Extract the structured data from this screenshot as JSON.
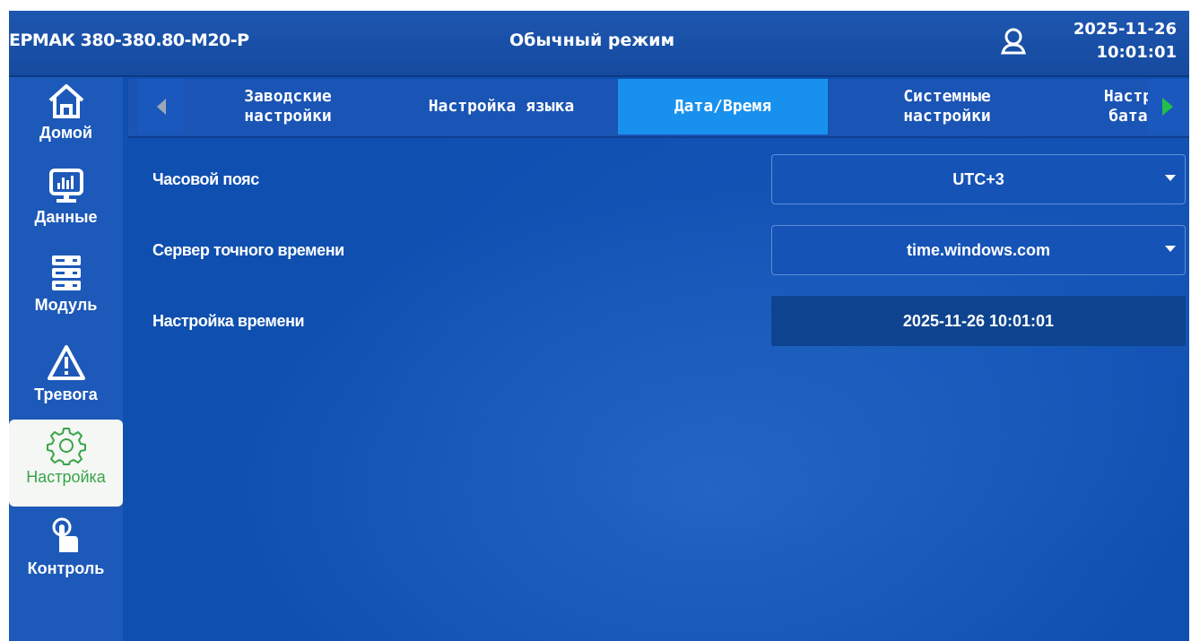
{
  "header": {
    "model": "ЕРМАК 380-380.80-М20-Р",
    "mode": "Обычный режим",
    "user_icon": "user-icon",
    "date": "2025-11-26",
    "time": "10:01:01"
  },
  "sidebar": {
    "items": [
      {
        "label": "Домой",
        "icon": "home-icon"
      },
      {
        "label": "Данные",
        "icon": "monitor-chart-icon"
      },
      {
        "label": "Модуль",
        "icon": "server-icon"
      },
      {
        "label": "Тревога",
        "icon": "warning-icon"
      },
      {
        "label": "Настройка",
        "icon": "gear-icon",
        "active": true
      },
      {
        "label": "Контроль",
        "icon": "touch-icon"
      }
    ]
  },
  "tabs": {
    "items": [
      {
        "label": "Заводские\nнастройки"
      },
      {
        "label": "Настройка языка"
      },
      {
        "label": "Дата/Время",
        "active": true
      },
      {
        "label": "Системные\nнастройки"
      },
      {
        "label": "Настр\nбата"
      }
    ]
  },
  "settings": {
    "timezone_label": "Часовой пояс",
    "timezone_value": "UTC+3",
    "ntp_label": "Сервер точного времени",
    "ntp_value": "time.windows.com",
    "time_label": "Настройка времени",
    "time_value": "2025-11-26 10:01:01"
  },
  "colors": {
    "background": "#0f4fb0",
    "active_tab": "#1890ee",
    "active_side_text": "#39a44a",
    "arrow_green": "#22c04a",
    "arrow_gray": "#9aa7b8"
  }
}
